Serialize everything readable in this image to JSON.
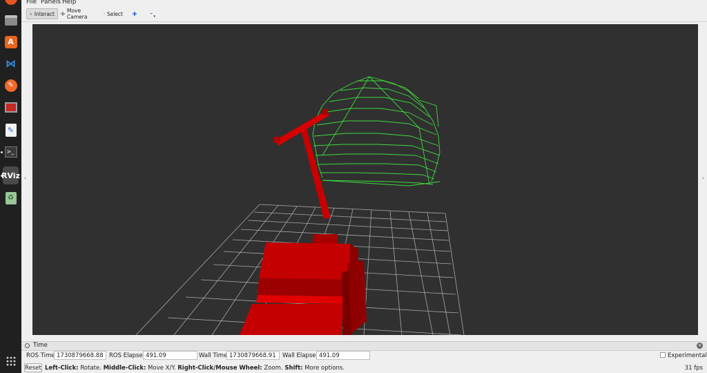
{
  "menu": {
    "file": "File",
    "panels": "Panels",
    "help": "Help"
  },
  "toolbar": {
    "interact": "Interact",
    "move_camera": "Move Camera",
    "select": "Select"
  },
  "dock": {
    "rviz_label": "RViz"
  },
  "time_panel": {
    "title": "Time",
    "ros_time_label": "ROS Time:",
    "ros_time_value": "1730879668.88",
    "ros_elapsed_label": "ROS Elapsed:",
    "ros_elapsed_value": "491.09",
    "wall_time_label": "Wall Time:",
    "wall_time_value": "1730879668.91",
    "wall_elapsed_label": "Wall Elapsed:",
    "wall_elapsed_value": "491.09",
    "experimental_label": "Experimental"
  },
  "status": {
    "reset_label": "Reset",
    "hint_left_click": "Left-Click:",
    "hint_rotate": " Rotate. ",
    "hint_middle_click": "Middle-Click:",
    "hint_move": " Move X/Y. ",
    "hint_right_click": "Right-Click/Mouse Wheel:",
    "hint_zoom": " Zoom. ",
    "hint_shift": "Shift:",
    "hint_more": " More options.",
    "fps": "31 fps"
  },
  "colors": {
    "viewport_bg": "#303030",
    "grid": "#a0a0a0",
    "robot": "#d40000",
    "scan": "#3ddc3d",
    "dock_bg": "#202020"
  }
}
